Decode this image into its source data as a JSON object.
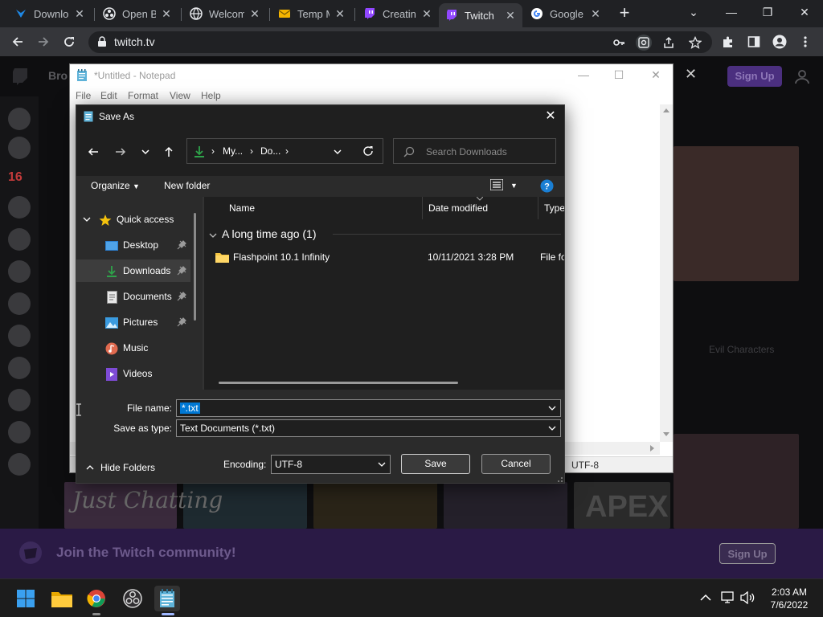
{
  "browser": {
    "tabs": [
      {
        "label": "Downlo",
        "icon": "tridex-icon"
      },
      {
        "label": "Open Br",
        "icon": "obs-icon"
      },
      {
        "label": "Welcom",
        "icon": "globe-icon"
      },
      {
        "label": "Temp M",
        "icon": "mail-icon"
      },
      {
        "label": "Creating",
        "icon": "twitch-icon"
      },
      {
        "label": "Twitch",
        "icon": "twitch-icon"
      },
      {
        "label": "Google",
        "icon": "google-icon"
      }
    ],
    "url": "twitch.tv"
  },
  "twitch": {
    "brow": "Bro",
    "signup_top": "Sign Up",
    "community_text": "Join the Twitch community!",
    "community_button": "Sign Up",
    "evil_characters": "Evil Characters",
    "category1": "Just Chatting",
    "category2": "APEX",
    "side_num": "16"
  },
  "notepad": {
    "title": "*Untitled - Notepad",
    "menu": [
      "File",
      "Edit",
      "Format",
      "View",
      "Help"
    ],
    "encoding": "UTF-8"
  },
  "save_dialog": {
    "title": "Save As",
    "breadcrumb": [
      "My...",
      "Do..."
    ],
    "search_placeholder": "Search Downloads",
    "organize": "Organize",
    "new_folder": "New folder",
    "nav_items": [
      {
        "label": "Quick access",
        "icon": "star-icon"
      },
      {
        "label": "Desktop",
        "icon": "desktop-icon"
      },
      {
        "label": "Downloads",
        "icon": "download-icon"
      },
      {
        "label": "Documents",
        "icon": "documents-icon"
      },
      {
        "label": "Pictures",
        "icon": "pictures-icon"
      },
      {
        "label": "Music",
        "icon": "music-icon"
      },
      {
        "label": "Videos",
        "icon": "videos-icon"
      }
    ],
    "columns": {
      "name": "Name",
      "date": "Date modified",
      "type": "Type"
    },
    "group": "A long time ago (1)",
    "files": [
      {
        "name": "Flashpoint 10.1 Infinity",
        "date": "10/11/2021 3:28 PM",
        "type": "File folder"
      }
    ],
    "file_name_label": "File name:",
    "file_name_value": "*.txt",
    "save_type_label": "Save as type:",
    "save_type_value": "Text Documents (*.txt)",
    "hide_folders": "Hide Folders",
    "encoding_label": "Encoding:",
    "encoding_value": "UTF-8",
    "save": "Save",
    "cancel": "Cancel"
  },
  "taskbar": {
    "time": "2:03 AM",
    "date": "7/6/2022"
  },
  "colors": {
    "accent": "#0078d4",
    "twitch_purple": "#9147ff"
  }
}
